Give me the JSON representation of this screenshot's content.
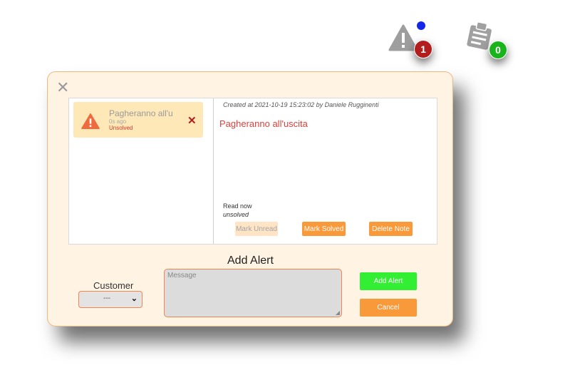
{
  "notifications": {
    "alerts": {
      "icon": "warning-triangle-icon",
      "count": "1",
      "unread_dot": true
    },
    "notes": {
      "icon": "clipboard-icon",
      "count": "0"
    }
  },
  "modal": {
    "close_icon": "close-icon",
    "alert_list": [
      {
        "title": "Pagheranno all'u",
        "time": "0s ago",
        "status": "Unsolved",
        "icon": "warning-triangle-icon"
      }
    ],
    "detail": {
      "created": "Created at 2021-10-19 15:23:02 by Daniele Rugginenti",
      "title": "Pagheranno all'uscita",
      "read_status": "Read now",
      "solved_status": "unsolved",
      "buttons": {
        "mark_unread": "Mark Unread",
        "mark_solved": "Mark Solved",
        "delete_note": "Delete Note"
      }
    },
    "add_alert": {
      "heading": "Add Alert",
      "customer_label": "Customer",
      "customer_value": "---",
      "message_placeholder": "Message",
      "add_button": "Add Alert",
      "cancel_button": "Cancel"
    }
  },
  "colors": {
    "modal_bg": "#fff3e3",
    "accent_orange": "#f89a3a",
    "add_green": "#33ef33",
    "alert_red": "#e0403a",
    "badge_red": "#b21e1e",
    "badge_green": "#19b31c"
  }
}
